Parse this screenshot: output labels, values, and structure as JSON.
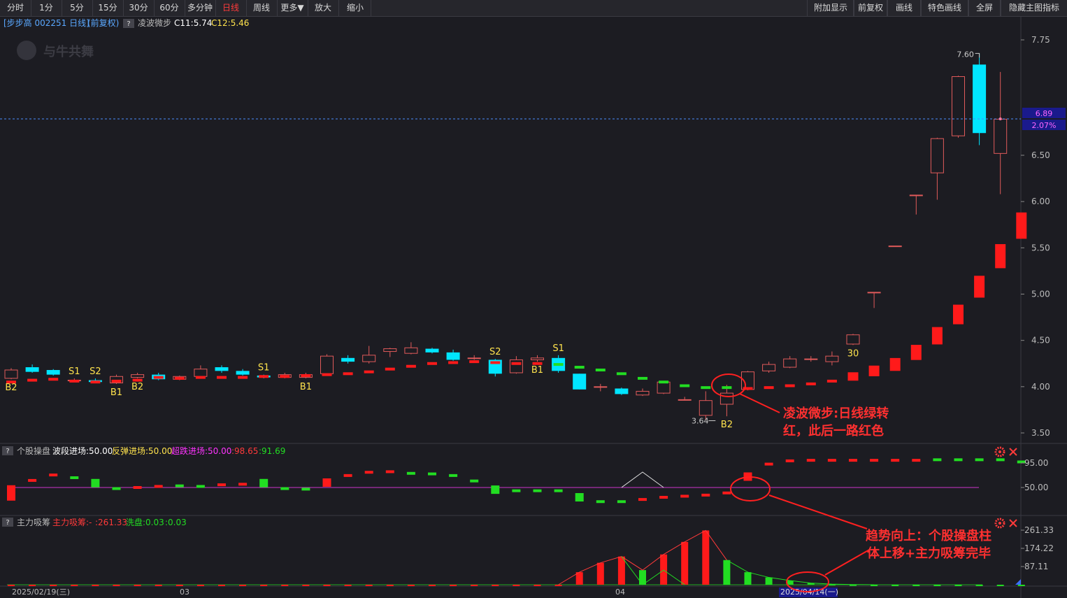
{
  "toolbar": {
    "left": [
      "分时",
      "1分",
      "5分",
      "15分",
      "30分",
      "60分",
      "多分钟",
      "日线",
      "周线",
      "更多▼",
      "放大",
      "缩小"
    ],
    "active": "日线",
    "right": [
      "附加显示",
      "前复权",
      "画线",
      "特色画线",
      "全屏",
      "隐藏主图指标"
    ]
  },
  "main_header": {
    "stock": "[步步高 002251 日线]",
    "adj": "(前复权)",
    "q": "?",
    "indicator": "凌波微步",
    "c11": "C11:5.74",
    "c12": "C12:5.46"
  },
  "panel2_header": {
    "q": "?",
    "name": "个股操盘",
    "f1": "波段进场:50.00",
    "f2": "反弹进场:50.00",
    "f3": "超跌进场:50.00",
    "f4": ":98.65",
    "f5": ":91.69"
  },
  "panel3_header": {
    "q": "?",
    "name": "主力吸筹",
    "f1": "主力吸筹:-",
    "f2": ":261.33",
    "f3": "洗盘:0.03",
    "f4": ":0.03"
  },
  "price_box": {
    "price": "6.89",
    "pct": "2.07%"
  },
  "annotations": {
    "a1_line1": "凌波微步:日线绿转",
    "a1_line2": "红，此后一路红色",
    "a2_line1": "趋势向上：个股操盘柱",
    "a2_line2": "体上移+主力吸筹完毕"
  },
  "watermark": "与牛共舞",
  "colors": {
    "up": "#ff3a3a",
    "down": "#00e5ff",
    "ma_red": "#ff1a1a",
    "ma_green": "#22dd22",
    "signal": "#ffe34d",
    "accent_blue": "#1a1aa0"
  },
  "chart_data": [
    {
      "type": "candlestick",
      "dates_label": [
        "2025/02/19(三)",
        "03",
        "04",
        "2025/04/14(一)"
      ],
      "yticks": [
        3.5,
        4.0,
        4.5,
        5.0,
        5.5,
        6.0,
        6.5,
        7.75
      ],
      "ylim": [
        3.45,
        7.85
      ],
      "high_label": "7.60",
      "low_label": "3.64",
      "candles": [
        {
          "o": 4.09,
          "c": 4.18,
          "h": 4.2,
          "l": 4.08
        },
        {
          "o": 4.21,
          "c": 4.16,
          "h": 4.24,
          "l": 4.15
        },
        {
          "o": 4.18,
          "c": 4.13,
          "h": 4.19,
          "l": 4.12
        },
        {
          "o": 4.07,
          "c": 4.07,
          "h": 4.09,
          "l": 4.05
        },
        {
          "o": 4.07,
          "c": 4.05,
          "h": 4.09,
          "l": 4.04
        },
        {
          "o": 4.04,
          "c": 4.11,
          "h": 4.13,
          "l": 4.03
        },
        {
          "o": 4.1,
          "c": 4.13,
          "h": 4.15,
          "l": 4.09
        },
        {
          "o": 4.13,
          "c": 4.08,
          "h": 4.15,
          "l": 4.07
        },
        {
          "o": 4.08,
          "c": 4.11,
          "h": 4.12,
          "l": 4.07
        },
        {
          "o": 4.11,
          "c": 4.19,
          "h": 4.23,
          "l": 4.1
        },
        {
          "o": 4.21,
          "c": 4.17,
          "h": 4.23,
          "l": 4.15
        },
        {
          "o": 4.17,
          "c": 4.13,
          "h": 4.19,
          "l": 4.12
        },
        {
          "o": 4.12,
          "c": 4.1,
          "h": 4.13,
          "l": 4.09
        },
        {
          "o": 4.1,
          "c": 4.13,
          "h": 4.15,
          "l": 4.09
        },
        {
          "o": 4.1,
          "c": 4.13,
          "h": 4.15,
          "l": 4.09
        },
        {
          "o": 4.14,
          "c": 4.33,
          "h": 4.35,
          "l": 4.12
        },
        {
          "o": 4.31,
          "c": 4.27,
          "h": 4.34,
          "l": 4.25
        },
        {
          "o": 4.27,
          "c": 4.34,
          "h": 4.44,
          "l": 4.25
        },
        {
          "o": 4.38,
          "c": 4.41,
          "h": 4.42,
          "l": 4.32
        },
        {
          "o": 4.36,
          "c": 4.42,
          "h": 4.48,
          "l": 4.35
        },
        {
          "o": 4.41,
          "c": 4.37,
          "h": 4.42,
          "l": 4.36
        },
        {
          "o": 4.37,
          "c": 4.29,
          "h": 4.4,
          "l": 4.28
        },
        {
          "o": 4.31,
          "c": 4.31,
          "h": 4.34,
          "l": 4.29
        },
        {
          "o": 4.29,
          "c": 4.14,
          "h": 4.3,
          "l": 4.11
        },
        {
          "o": 4.15,
          "c": 4.29,
          "h": 4.33,
          "l": 4.14
        },
        {
          "o": 4.29,
          "c": 4.31,
          "h": 4.34,
          "l": 4.27
        },
        {
          "o": 4.31,
          "c": 4.17,
          "h": 4.34,
          "l": 4.15
        },
        {
          "o": 4.14,
          "c": 3.97,
          "h": 4.14,
          "l": 3.97
        },
        {
          "o": 4.0,
          "c": 4.0,
          "h": 4.03,
          "l": 3.95
        },
        {
          "o": 3.98,
          "c": 3.92,
          "h": 3.99,
          "l": 3.91
        },
        {
          "o": 3.91,
          "c": 3.95,
          "h": 3.98,
          "l": 3.9
        },
        {
          "o": 3.93,
          "c": 4.05,
          "h": 4.06,
          "l": 3.92
        },
        {
          "o": 3.86,
          "c": 3.86,
          "h": 3.89,
          "l": 3.85
        },
        {
          "o": 3.69,
          "c": 3.85,
          "h": 3.95,
          "l": 3.64
        },
        {
          "o": 3.81,
          "c": 3.93,
          "h": 4.02,
          "l": 3.68
        },
        {
          "o": 3.97,
          "c": 4.16,
          "h": 4.17,
          "l": 3.96
        },
        {
          "o": 4.17,
          "c": 4.24,
          "h": 4.27,
          "l": 4.15
        },
        {
          "o": 4.21,
          "c": 4.3,
          "h": 4.33,
          "l": 4.2
        },
        {
          "o": 4.3,
          "c": 4.3,
          "h": 4.33,
          "l": 4.27
        },
        {
          "o": 4.27,
          "c": 4.33,
          "h": 4.38,
          "l": 4.23
        },
        {
          "o": 4.46,
          "c": 4.56,
          "h": 4.57,
          "l": 4.45
        },
        {
          "o": 5.02,
          "c": 5.02,
          "h": 5.02,
          "l": 4.85
        },
        {
          "o": 5.52,
          "c": 5.52,
          "h": 5.52,
          "l": 5.52
        },
        {
          "o": 6.07,
          "c": 6.07,
          "h": 6.07,
          "l": 5.86
        },
        {
          "o": 6.31,
          "c": 6.68,
          "h": 6.69,
          "l": 6.02
        },
        {
          "o": 6.71,
          "c": 7.35,
          "h": 7.36,
          "l": 6.69
        },
        {
          "o": 7.48,
          "c": 6.74,
          "h": 7.6,
          "l": 6.61
        },
        {
          "o": 6.52,
          "c": 6.89,
          "h": 7.4,
          "l": 6.08
        }
      ],
      "ma": [
        4.05,
        4.07,
        4.08,
        4.06,
        4.05,
        4.06,
        4.07,
        4.1,
        4.09,
        4.1,
        4.1,
        4.1,
        4.11,
        4.11,
        4.12,
        4.13,
        4.14,
        4.16,
        4.19,
        4.22,
        4.25,
        4.26,
        4.27,
        4.26,
        4.25,
        4.25,
        4.24,
        4.21,
        4.18,
        4.14,
        4.09,
        4.05,
        4.01,
        3.99,
        3.99,
        3.98,
        3.99,
        4.01,
        4.03,
        4.06,
        4.11,
        4.17,
        4.24,
        4.37,
        4.55,
        4.78,
        5.08,
        5.41,
        5.74
      ],
      "ma_color": [
        "r",
        "r",
        "r",
        "r",
        "r",
        "r",
        "r",
        "r",
        "r",
        "r",
        "r",
        "r",
        "r",
        "r",
        "r",
        "r",
        "r",
        "r",
        "r",
        "r",
        "r",
        "r",
        "r",
        "r",
        "r",
        "r",
        "g",
        "g",
        "g",
        "g",
        "g",
        "g",
        "g",
        "g",
        "g",
        "r",
        "r",
        "r",
        "r",
        "r",
        "r",
        "r",
        "r",
        "r",
        "r",
        "r",
        "r",
        "r",
        "r"
      ],
      "signals": [
        {
          "i": 0,
          "t": "B2",
          "pos": "below"
        },
        {
          "i": 3,
          "t": "S1",
          "pos": "above"
        },
        {
          "i": 4,
          "t": "S2",
          "pos": "above"
        },
        {
          "i": 5,
          "t": "B1",
          "pos": "below"
        },
        {
          "i": 6,
          "t": "B2",
          "pos": "below"
        },
        {
          "i": 12,
          "t": "S1",
          "pos": "above"
        },
        {
          "i": 14,
          "t": "B1",
          "pos": "below"
        },
        {
          "i": 23,
          "t": "S2",
          "pos": "above"
        },
        {
          "i": 25,
          "t": "B1",
          "pos": "below"
        },
        {
          "i": 26,
          "t": "S1",
          "pos": "above"
        },
        {
          "i": 34,
          "t": "B2",
          "pos": "below"
        },
        {
          "i": 40,
          "t": "30",
          "pos": "below"
        }
      ]
    },
    {
      "type": "bar",
      "name": "个股操盘",
      "yticks": [
        50.0,
        95.0
      ],
      "ylim": [
        20,
        108
      ],
      "values": [
        40,
        63,
        73,
        68,
        58,
        48,
        50,
        52,
        53,
        52,
        55,
        56,
        58,
        48,
        47,
        59,
        72,
        78,
        79,
        76,
        75,
        72,
        62,
        46,
        44,
        44,
        44,
        32,
        24,
        24,
        28,
        32,
        34,
        36,
        40,
        70,
        93,
        99,
        100,
        100,
        100,
        100,
        100,
        100,
        101,
        101,
        101,
        101,
        97
      ],
      "color": [
        "r",
        "r",
        "r",
        "g",
        "g",
        "g",
        "r",
        "r",
        "g",
        "g",
        "r",
        "r",
        "g",
        "g",
        "g",
        "r",
        "r",
        "r",
        "r",
        "g",
        "g",
        "g",
        "g",
        "g",
        "g",
        "g",
        "g",
        "g",
        "g",
        "g",
        "r",
        "r",
        "r",
        "r",
        "r",
        "r",
        "r",
        "r",
        "r",
        "r",
        "r",
        "r",
        "r",
        "r",
        "g",
        "g",
        "g",
        "g",
        "g"
      ],
      "baseline": 50
    },
    {
      "type": "bar",
      "name": "主力吸筹",
      "yticks": [
        87.11,
        174.22,
        261.33
      ],
      "ylim": [
        0,
        280
      ],
      "values": [
        0,
        0,
        0,
        0,
        0,
        0,
        0,
        0,
        0,
        0,
        0,
        0,
        0,
        0,
        0,
        0,
        0,
        0,
        0,
        0,
        0,
        0,
        0,
        0,
        0,
        0,
        0,
        60,
        105,
        135,
        70,
        145,
        205,
        260,
        118,
        60,
        35,
        20,
        8,
        3,
        1,
        0,
        0,
        0,
        0,
        0,
        0,
        0,
        0
      ],
      "color": [
        "r",
        "r",
        "r",
        "r",
        "r",
        "r",
        "r",
        "r",
        "r",
        "r",
        "r",
        "r",
        "r",
        "r",
        "r",
        "r",
        "r",
        "r",
        "r",
        "r",
        "r",
        "r",
        "r",
        "r",
        "r",
        "r",
        "r",
        "r",
        "r",
        "r",
        "g",
        "r",
        "r",
        "r",
        "g",
        "g",
        "g",
        "g",
        "g",
        "g",
        "g",
        "g",
        "g",
        "g",
        "g",
        "g",
        "g",
        "g",
        "g"
      ]
    }
  ]
}
